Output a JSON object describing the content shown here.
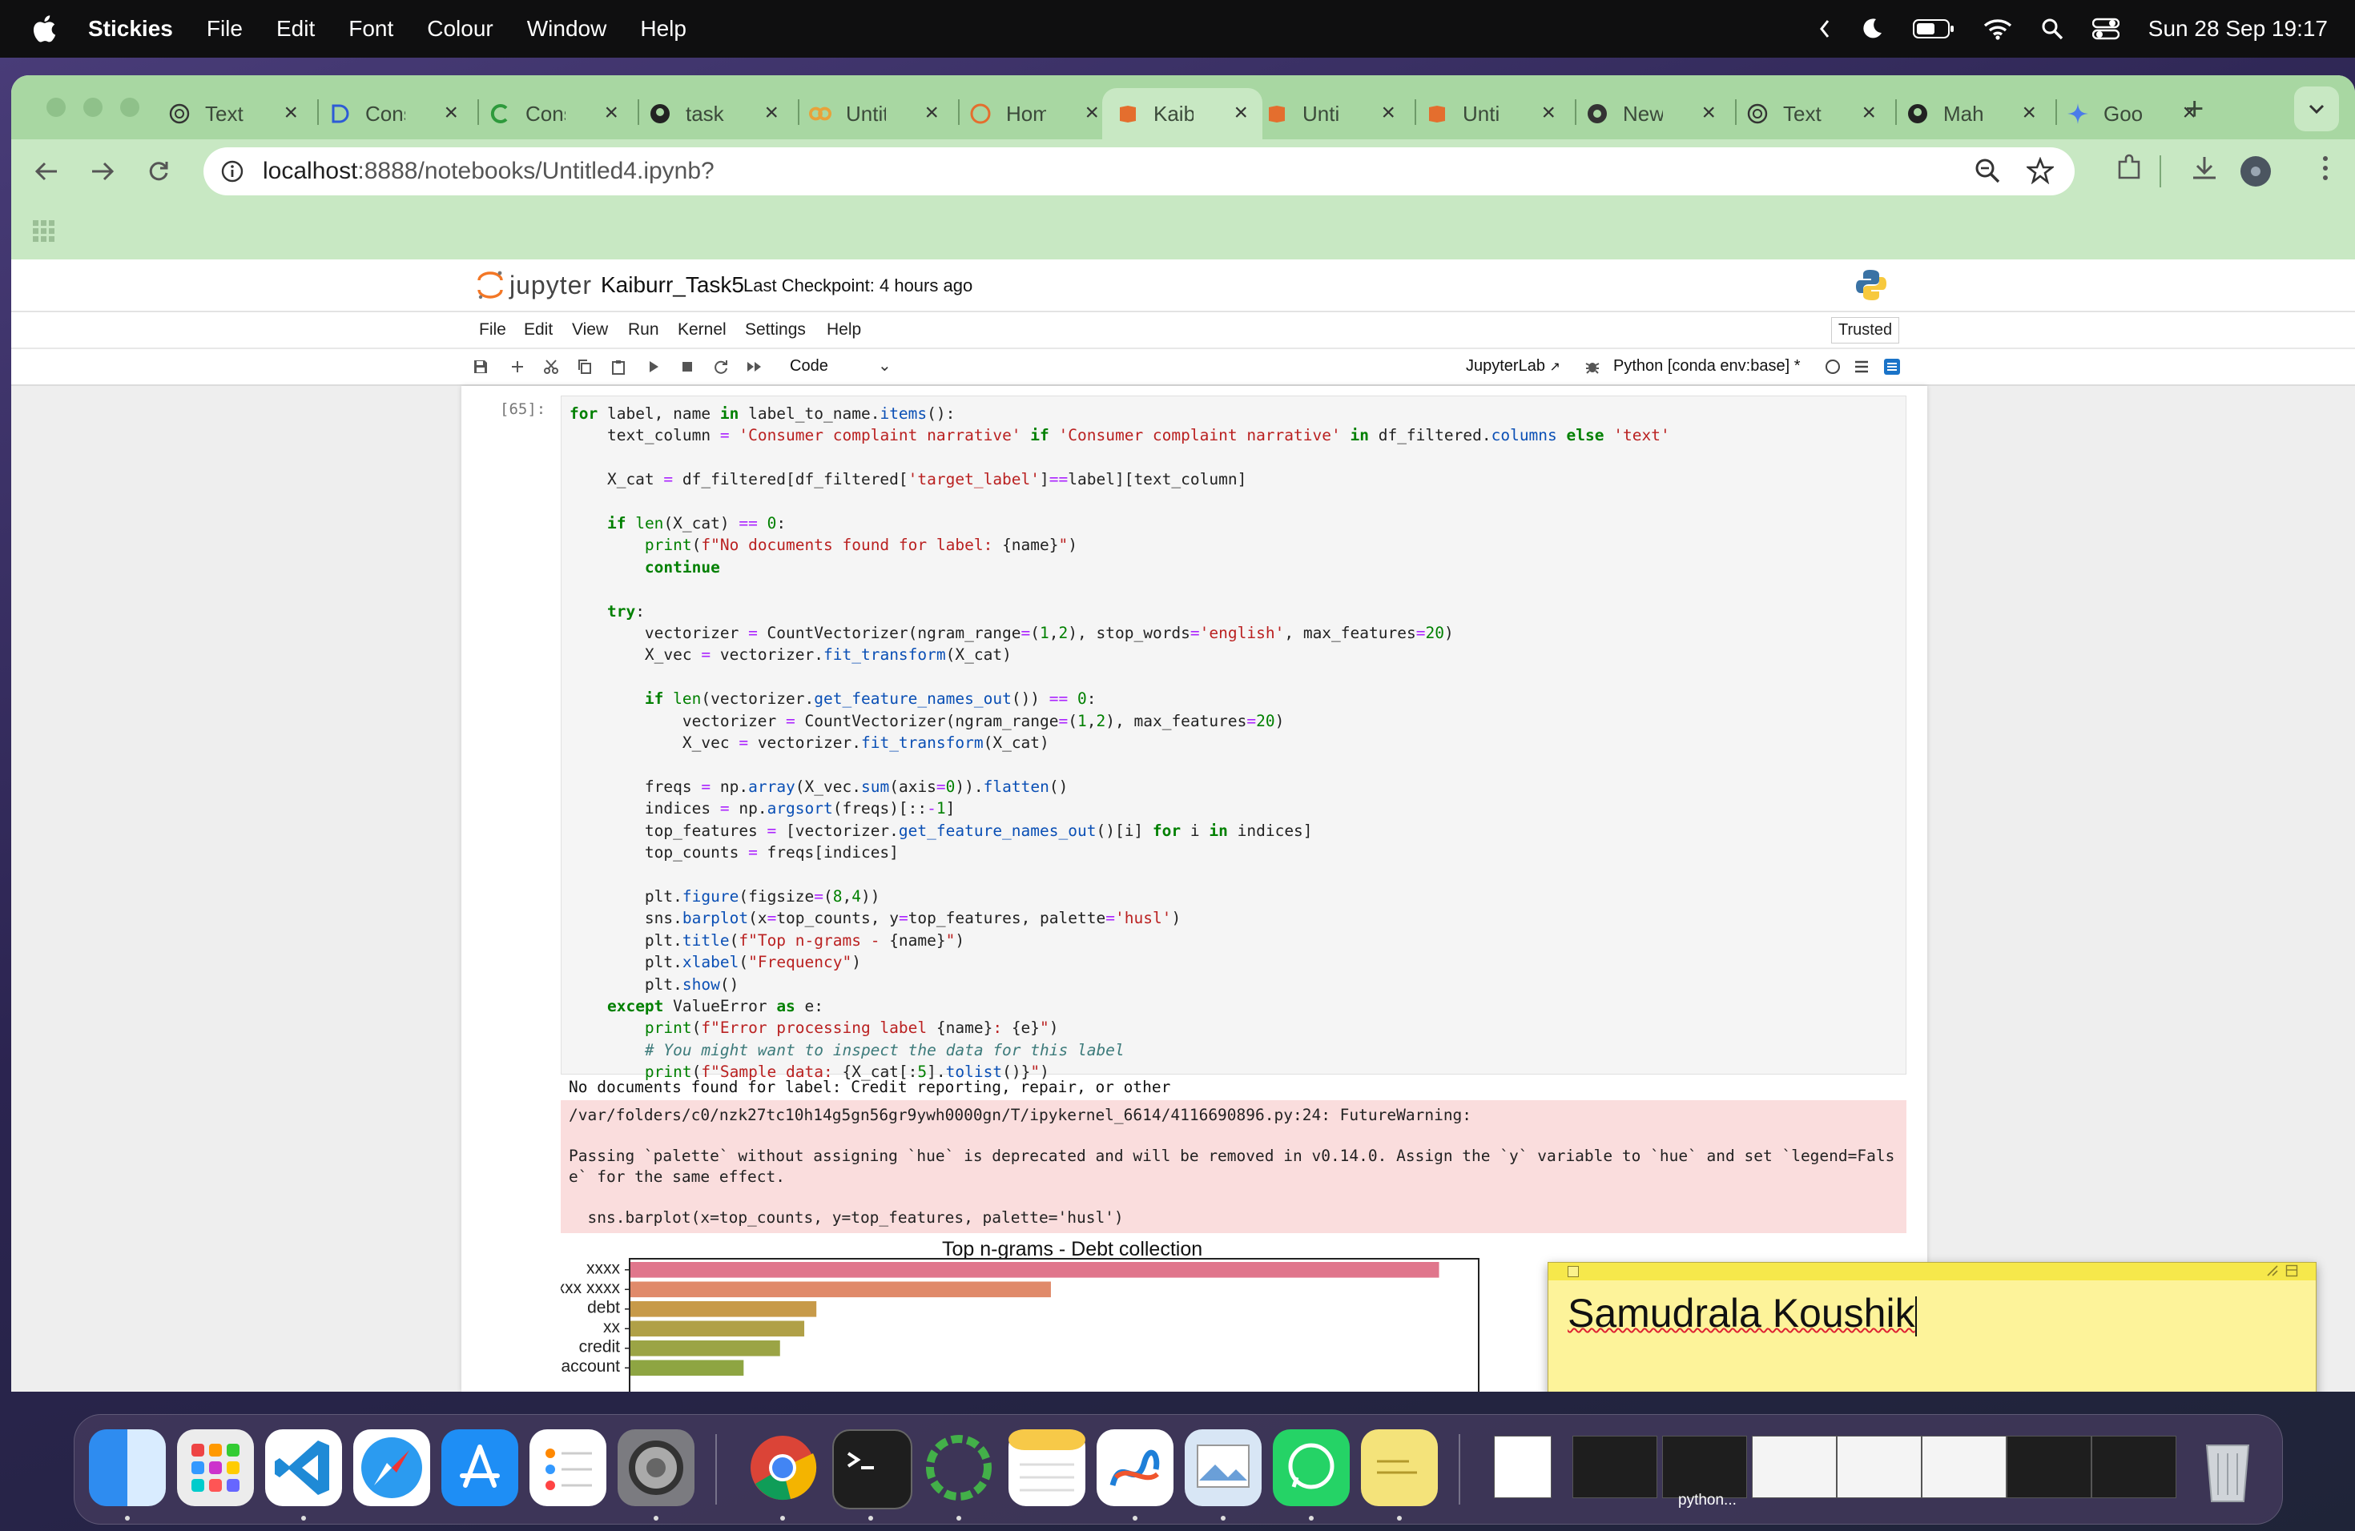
{
  "menubar": {
    "app_name": "Stickies",
    "items": [
      "File",
      "Edit",
      "Font",
      "Colour",
      "Window",
      "Help"
    ],
    "clock": "Sun 28 Sep  19:17"
  },
  "browser": {
    "tabs": [
      {
        "label": "Text",
        "icon": "chatgpt-icon"
      },
      {
        "label": "Cons",
        "icon": "deepseek-icon"
      },
      {
        "label": "Cons",
        "icon": "c-icon"
      },
      {
        "label": "task",
        "icon": "github-icon"
      },
      {
        "label": "Untit",
        "icon": "colab-icon"
      },
      {
        "label": "Hom",
        "icon": "jupyter-icon"
      },
      {
        "label": "Kaib",
        "icon": "jupyter-book-icon",
        "active": true
      },
      {
        "label": "Unti",
        "icon": "jupyter-book-icon"
      },
      {
        "label": "Unti",
        "icon": "jupyter-book-icon"
      },
      {
        "label": "New",
        "icon": "chrome-icon"
      },
      {
        "label": "Text",
        "icon": "chatgpt-icon"
      },
      {
        "label": "Mah",
        "icon": "github-icon"
      },
      {
        "label": "Goo",
        "icon": "gemini-icon"
      }
    ],
    "url_host": "localhost",
    "url_path": ":8888/notebooks/Untitled4.ipynb?"
  },
  "jupyter": {
    "logo_text": "jupyter",
    "notebook_name": "Kaiburr_Task5",
    "checkpoint": "Last Checkpoint: 4 hours ago",
    "menu": [
      "File",
      "Edit",
      "View",
      "Run",
      "Kernel",
      "Settings",
      "Help"
    ],
    "trusted": "Trusted",
    "cell_type": "Code",
    "jupyterlab_link": "JupyterLab",
    "kernel": "Python [conda env:base] *",
    "prompt": "[65]:",
    "output_line": "No documents found for label: Credit reporting, repair, or other",
    "stderr": "/var/folders/c0/nzk27tc10h14g5gn56gr9ywh0000gn/T/ipykernel_6614/4116690896.py:24: FutureWarning:\n\nPassing `palette` without assigning `hue` is deprecated and will be removed in v0.14.0. Assign the `y` variable to `hue` and set `legend=Fals\ne` for the same effect.\n\n  sns.barplot(x=top_counts, y=top_features, palette='husl')"
  },
  "chart_data": {
    "type": "bar",
    "orientation": "horizontal",
    "title": "Top n-grams - Debt collection",
    "categories": [
      "xxxx",
      "xxxx xxxx",
      "debt",
      "xx",
      "credit",
      "account"
    ],
    "values": [
      1000,
      520,
      230,
      215,
      185,
      140
    ],
    "colors": [
      "#e0768c",
      "#e08a6a",
      "#c79a49",
      "#b0a047",
      "#9ba445",
      "#8ea542"
    ],
    "xlabel": "",
    "ylabel": ""
  },
  "sticky": {
    "text": "Samudrala Koushik"
  },
  "dock": {
    "thumb_label": "python..."
  }
}
